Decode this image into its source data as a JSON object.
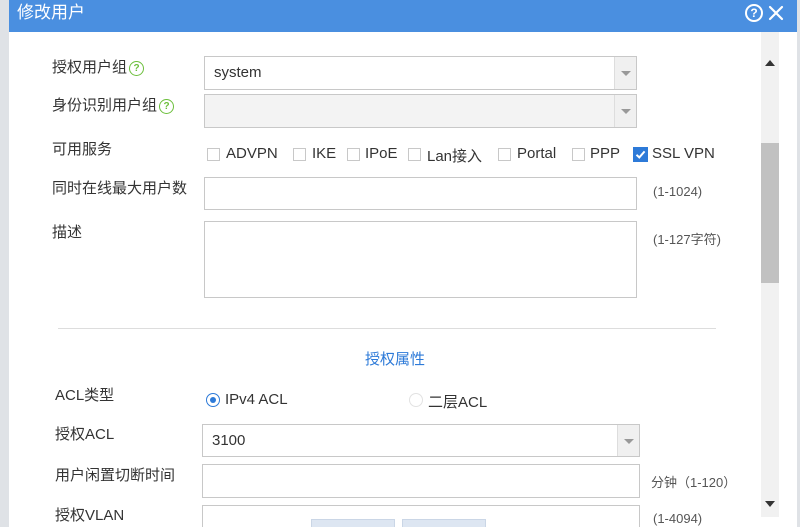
{
  "dialog": {
    "title": "修改用户"
  },
  "form": {
    "user_group": {
      "label": "授权用户组",
      "value": "system"
    },
    "identity_group": {
      "label": "身份识别用户组",
      "value": ""
    },
    "services": {
      "label": "可用服务",
      "items": [
        {
          "label": "ADVPN",
          "checked": false
        },
        {
          "label": "IKE",
          "checked": false
        },
        {
          "label": "IPoE",
          "checked": false
        },
        {
          "label": "Lan接入",
          "checked": false
        },
        {
          "label": "Portal",
          "checked": false
        },
        {
          "label": "PPP",
          "checked": false
        },
        {
          "label": "SSL VPN",
          "checked": true
        }
      ]
    },
    "max_online": {
      "label": "同时在线最大用户数",
      "value": "",
      "hint": "(1-1024)"
    },
    "description": {
      "label": "描述",
      "value": "",
      "hint": "(1-127字符)"
    }
  },
  "auth_section": {
    "title": "授权属性",
    "acl_type": {
      "label": "ACL类型",
      "options": [
        {
          "label": "IPv4 ACL",
          "selected": true
        },
        {
          "label": "二层ACL",
          "selected": false
        }
      ]
    },
    "acl": {
      "label": "授权ACL",
      "value": "3100"
    },
    "idle_cut": {
      "label": "用户闲置切断时间",
      "value": "",
      "hint": "分钟（1-120）"
    },
    "vlan": {
      "label": "授权VLAN",
      "value": "",
      "hint": "(1-4094)"
    }
  },
  "colors": {
    "title_bar": "#4a8fe0",
    "accent": "#2d7ad8",
    "help_green": "#6cbf3c"
  }
}
